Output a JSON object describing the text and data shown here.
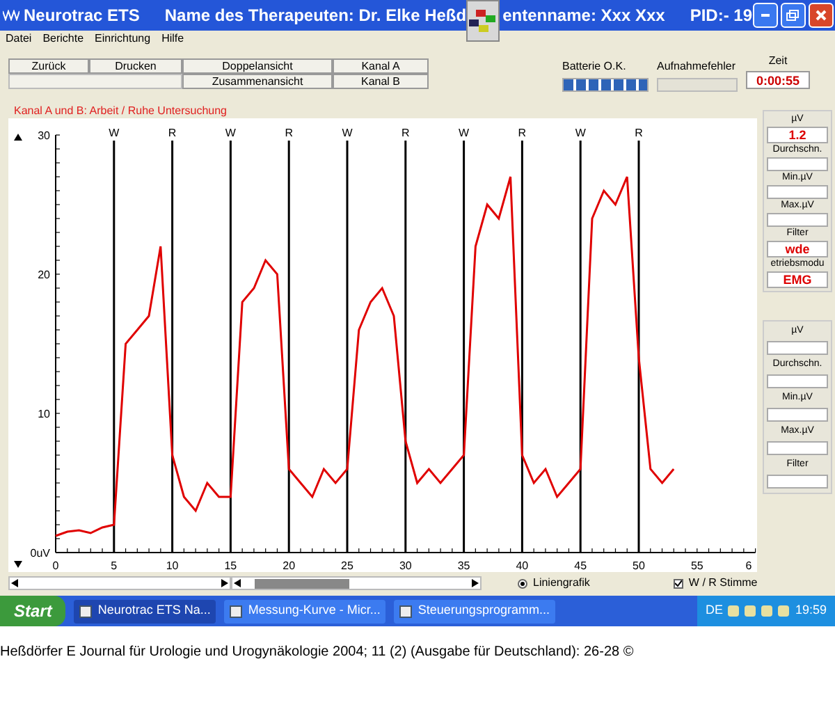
{
  "window": {
    "title_app": "Neurotrac ETS",
    "title_therapist": "Name des Therapeuten:  Dr. Elke Heßd",
    "title_patient": "entenname:  Xxx Xxx",
    "title_pid": "PID:- 19"
  },
  "menu": [
    "Datei",
    "Berichte",
    "Einrichtung",
    "Hilfe"
  ],
  "toolbar": {
    "buttons_row1": [
      "Zurück",
      "Drucken",
      "Doppelansicht",
      "Kanal A"
    ],
    "buttons_row2": [
      "Zusammenansicht",
      "Kanal B"
    ],
    "battery_label": "Batterie O.K.",
    "battery": {
      "level": 1
    },
    "error_label": "Aufnahmefehler",
    "time_label": "Zeit",
    "time": "0:00:55"
  },
  "chart_panel": {
    "x_axis_cut_label": "6",
    "phase_labels": [
      "W",
      "R",
      "W",
      "R",
      "W",
      "R",
      "W",
      "R",
      "W",
      "R"
    ],
    "chart_data": {
      "type": "line",
      "title": "Kanal A und B: Arbeit / Ruhe Untersuchung",
      "grid": true,
      "xlim": [
        0,
        60
      ],
      "ylim": [
        0,
        30
      ],
      "xticks": [
        0,
        5,
        10,
        15,
        20,
        25,
        30,
        35,
        40,
        45,
        50,
        55
      ],
      "yticks": [
        {
          "value": 0,
          "label": "0uV"
        },
        10,
        20,
        30
      ],
      "x": [
        0,
        1,
        2,
        3,
        4,
        5,
        6,
        7,
        8,
        9,
        10,
        11,
        12,
        13,
        14,
        15,
        16,
        17,
        18,
        19,
        20,
        21,
        22,
        23,
        24,
        25,
        26,
        27,
        28,
        29,
        30,
        31,
        32,
        33,
        34,
        35,
        36,
        37,
        38,
        39,
        40,
        41,
        42,
        43,
        44,
        45,
        46,
        47,
        48,
        49,
        50,
        51,
        52,
        53
      ],
      "series": [
        {
          "color": "#e00000",
          "values": [
            1.2,
            1.5,
            1.6,
            1.4,
            1.8,
            2,
            15,
            16,
            17,
            22,
            7,
            4,
            3,
            5,
            4,
            4,
            18,
            19,
            21,
            20,
            6,
            5,
            4,
            6,
            5,
            6,
            16,
            18,
            19,
            17,
            8,
            5,
            6,
            5,
            6,
            7,
            22,
            25,
            24,
            27,
            7,
            5,
            6,
            4,
            5,
            6,
            24,
            26,
            25,
            27,
            14,
            6,
            5,
            6
          ]
        }
      ]
    }
  },
  "side_panel": [
    {
      "label": "µV",
      "value": "1.2"
    },
    {
      "label": "Durchschn."
    },
    {
      "label": "Min.µV"
    },
    {
      "label": "Max.µV"
    },
    {
      "label": "Filter",
      "value": "wde"
    },
    {
      "label": "etriebsmodu",
      "value": "EMG"
    }
  ],
  "side_panel_b": [
    "µV",
    "Durchschn.",
    "Min.µV",
    "Max.µV",
    "Filter"
  ],
  "bottom": {
    "radio": {
      "label": "Liniengrafik",
      "selected": true
    },
    "checkbox": {
      "label": "W / R Stimme",
      "checked": true
    }
  },
  "taskbar": {
    "start": "Start",
    "tasks": [
      {
        "label": "Neurotrac ETS",
        "extra": "Na...",
        "selected": true
      },
      {
        "label": "Messung-Kurve - Micr...",
        "selected": false
      },
      {
        "label": "Steuerungsprogramm...",
        "selected": false
      }
    ],
    "language": "DE",
    "clock": "19:59"
  },
  "caption": "Heßdörfer E Journal für Urologie und Urogynäkologie 2004; 11 (2) (Ausgabe für Deutschland): 26-28 ©"
}
